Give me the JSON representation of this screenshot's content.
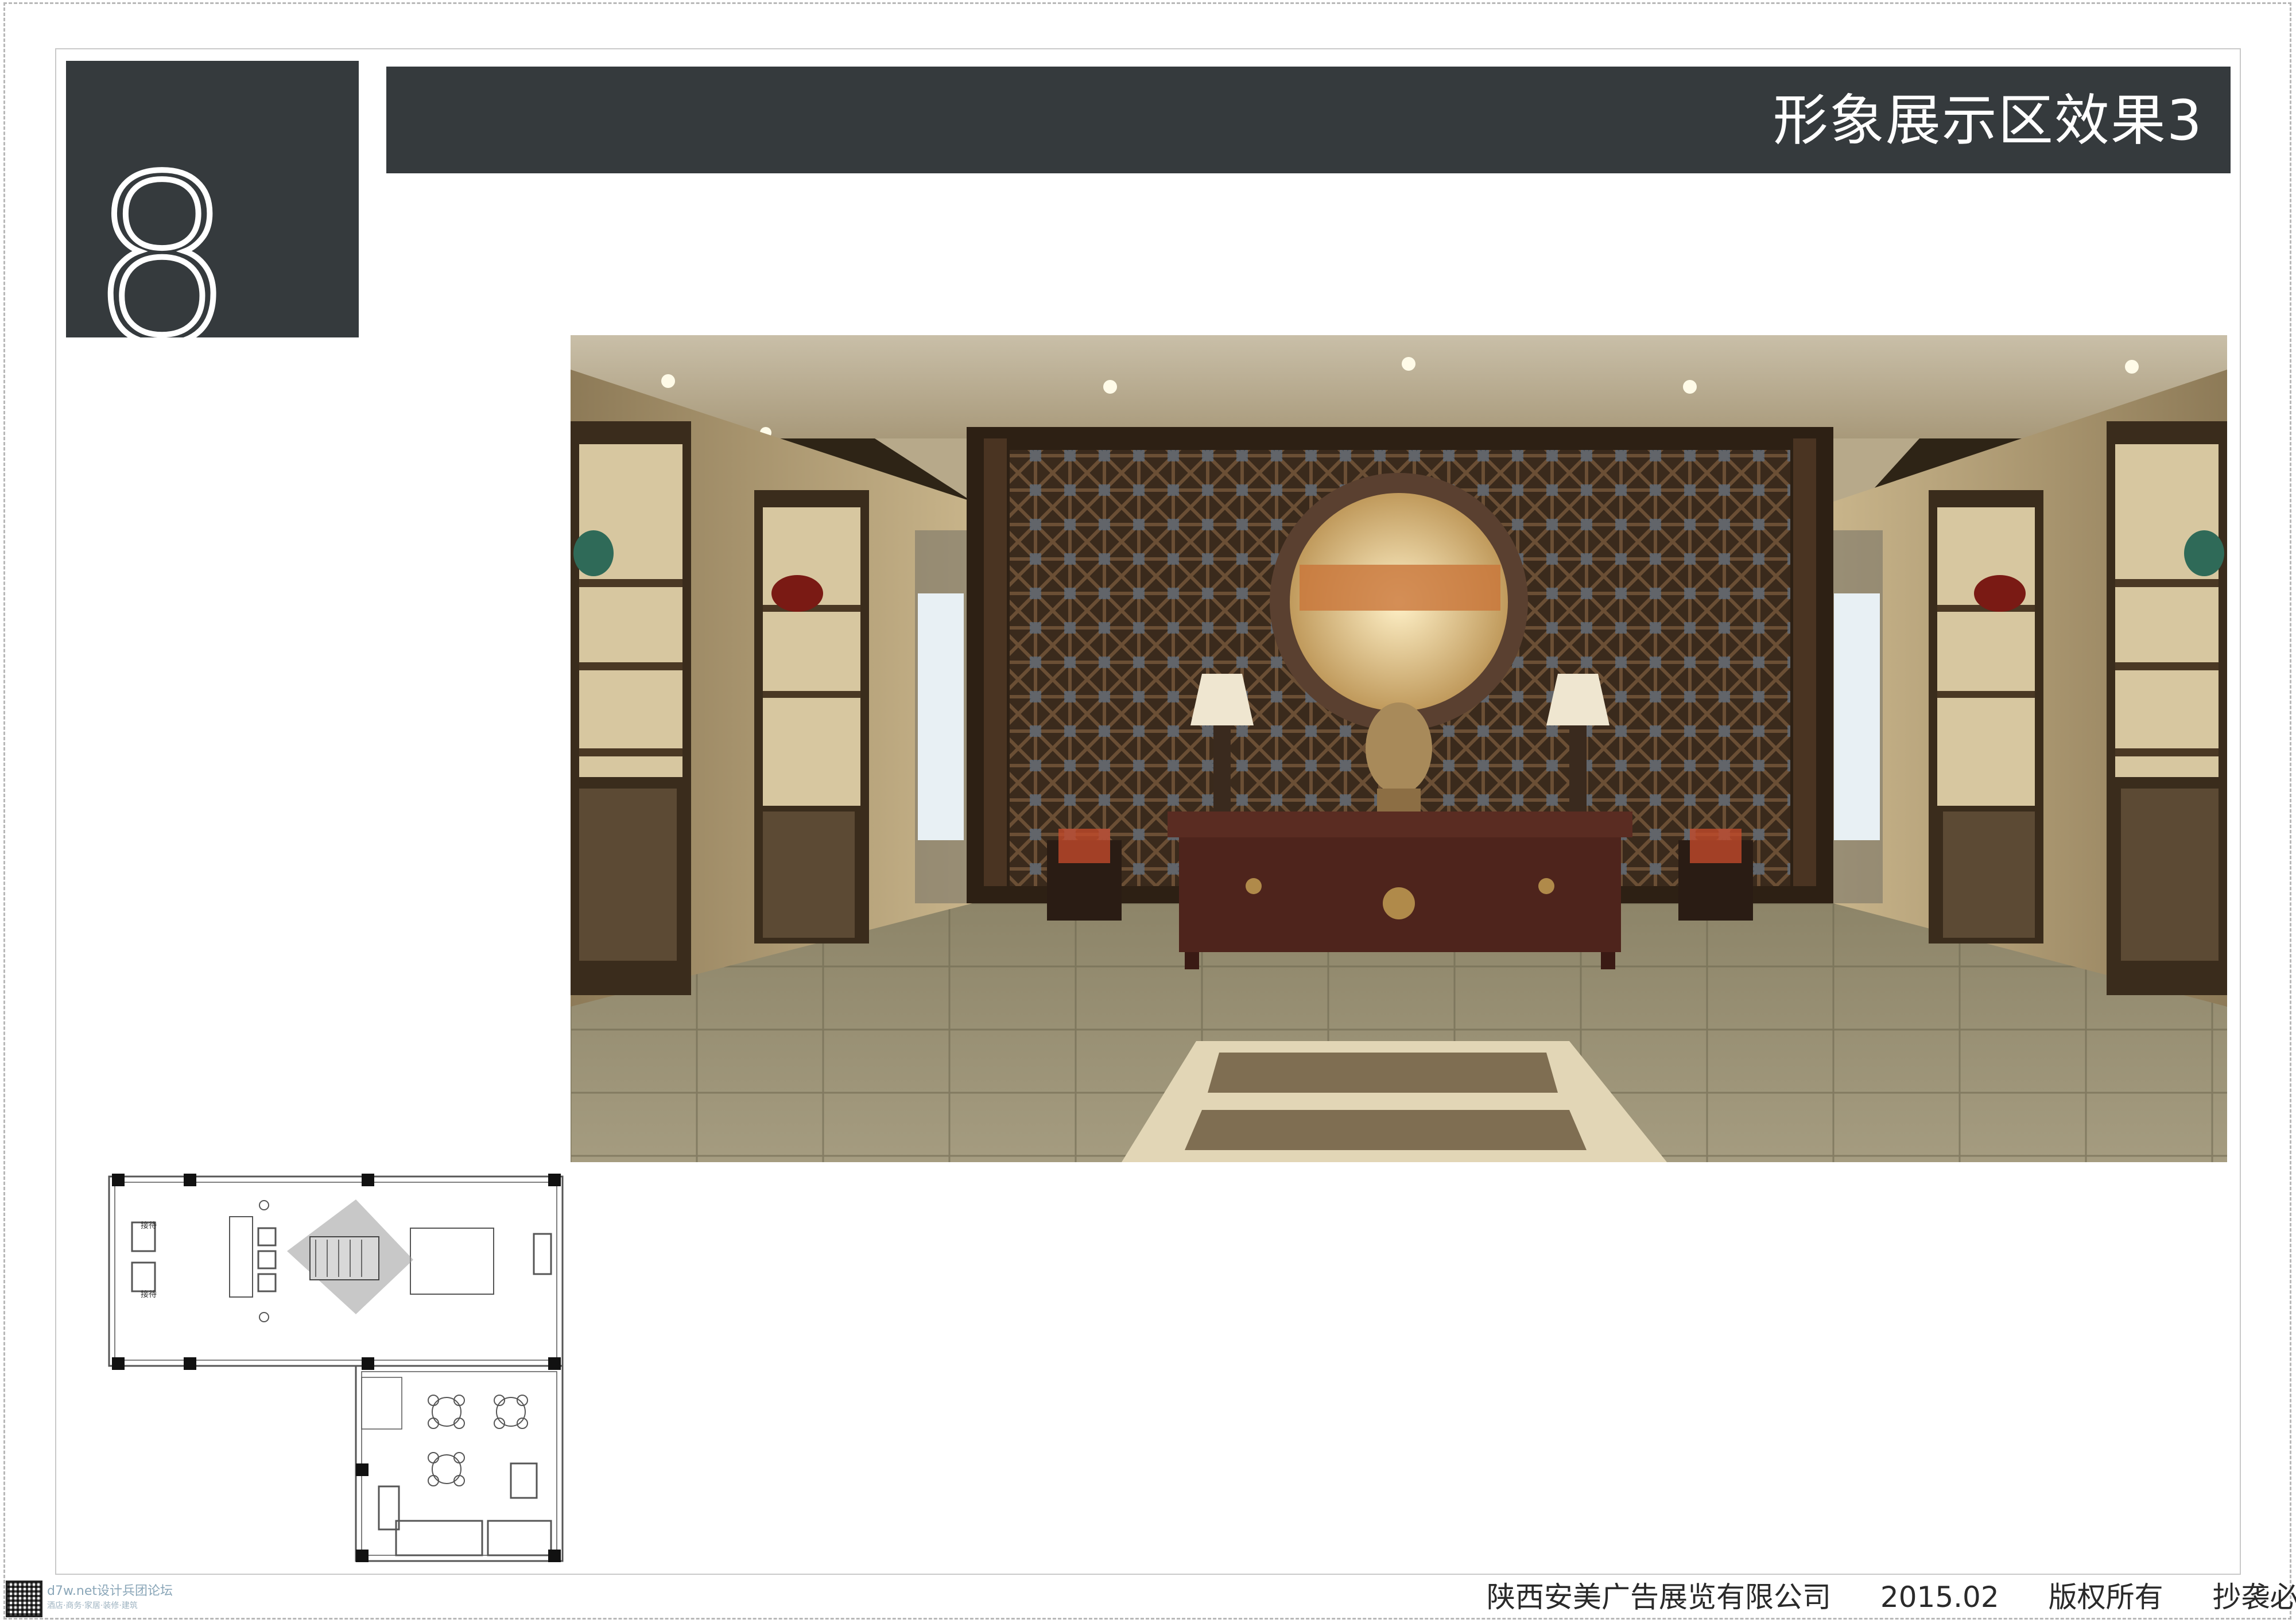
{
  "page": {
    "number": "8",
    "title": "形象展示区效果3"
  },
  "render": {
    "scene": "lobby-display-area-rendering"
  },
  "floor_plan": {
    "labels": [
      "接待",
      "接待"
    ],
    "view_cone_color": "#9a9a9a"
  },
  "footer": {
    "company": "陕西安美广告展览有限公司",
    "date": "2015.02",
    "copyright": "版权所有",
    "warning": "抄袭必究"
  },
  "watermark": {
    "site": "d7w.net设计兵团论坛",
    "tagline": "酒店·商务·家居·装修·建筑"
  },
  "colors": {
    "banner": "#353a3d",
    "banner_text": "#ffffff",
    "frame": "#c9c9c9"
  }
}
